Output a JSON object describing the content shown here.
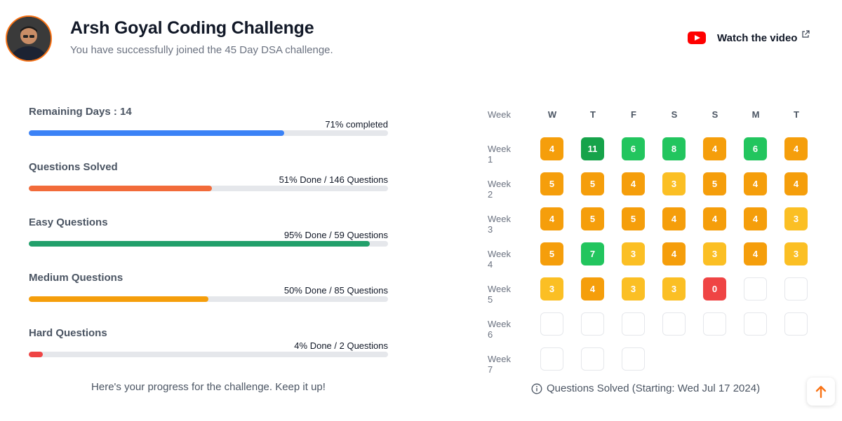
{
  "header": {
    "title": "Arsh Goyal Coding Challenge",
    "subtitle": "You have successfully joined the 45 Day DSA challenge.",
    "watch_label": "Watch the video",
    "icons": {
      "video": "youtube-icon",
      "external": "external-link-icon"
    }
  },
  "stats": [
    {
      "label": "Remaining Days : 14",
      "value": "71% completed",
      "progress": 0.71,
      "color": "#3b82f6"
    },
    {
      "label": "Questions Solved",
      "value": "51% Done / 146 Questions",
      "progress": 0.51,
      "color": "#f26b3a"
    },
    {
      "label": "Easy Questions",
      "value": "95% Done / 59 Questions",
      "progress": 0.95,
      "color": "#22a06b"
    },
    {
      "label": "Medium Questions",
      "value": "50% Done / 85 Questions",
      "progress": 0.5,
      "color": "#f59e0b"
    },
    {
      "label": "Hard Questions",
      "value": "4% Done / 2 Questions",
      "progress": 0.04,
      "color": "#ef4444"
    }
  ],
  "progress_footer": "Here's your progress for the challenge. Keep it up!",
  "calendar": {
    "week_header": "Week",
    "days": [
      "W",
      "T",
      "F",
      "S",
      "S",
      "M",
      "T"
    ],
    "weeks": [
      {
        "label": "Week 1",
        "values": [
          4,
          11,
          6,
          8,
          4,
          6,
          4
        ]
      },
      {
        "label": "Week 2",
        "values": [
          5,
          5,
          4,
          3,
          5,
          4,
          4
        ]
      },
      {
        "label": "Week 3",
        "values": [
          4,
          5,
          5,
          4,
          4,
          4,
          3
        ]
      },
      {
        "label": "Week 4",
        "values": [
          5,
          7,
          3,
          4,
          3,
          4,
          3
        ]
      },
      {
        "label": "Week 5",
        "values": [
          3,
          4,
          3,
          3,
          0,
          null,
          null
        ]
      },
      {
        "label": "Week 6",
        "values": [
          null,
          null,
          null,
          null,
          null,
          null,
          null
        ]
      },
      {
        "label": "Week 7",
        "values": [
          null,
          null,
          null
        ]
      }
    ],
    "colors": {
      "zero": "#ef4444",
      "low": "#fbbf24",
      "mid": "#f59e0b",
      "high": "#22c55e",
      "top": "#16a34a"
    },
    "footer": "Questions Solved (Starting: Wed Jul 17 2024)"
  }
}
